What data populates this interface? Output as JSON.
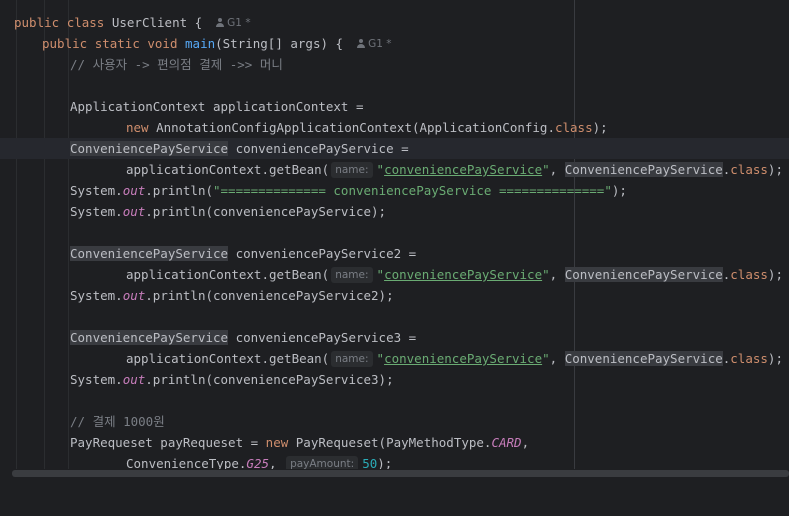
{
  "editor": {
    "author": "G1 *",
    "lines": {
      "l1": {
        "kw1": "public",
        "kw2": "class",
        "name": "UserClient {"
      },
      "l2": {
        "kw1": "public",
        "kw2": "static",
        "kw3": "void",
        "fn": "main",
        "rest": "(String[] args) {"
      },
      "l3": {
        "comment": "// 사용자 -> 편의점 결제 ->> 머니"
      },
      "l5": {
        "text": "ApplicationContext applicationContext ="
      },
      "l6": {
        "kw": "new",
        "text": "AnnotationConfigApplicationContext(ApplicationConfig.",
        "kw2": "class",
        "end": ");"
      },
      "l7": {
        "type": "ConveniencePayService",
        "text": " conveniencePayService ="
      },
      "l8": {
        "pre": "applicationContext.getBean(",
        "hint": "name:",
        "q1": "\"",
        "link": "conveniencePayService",
        "q2": "\"",
        "sep": ", ",
        "type": "ConveniencePayService",
        "dot": ".",
        "kw": "class",
        "end": ");"
      },
      "l9": {
        "pre": "System.",
        "out": "out",
        "mid": ".println(",
        "str": "\"============== conveniencePayService ==============\"",
        "end": ");"
      },
      "l10": {
        "pre": "System.",
        "out": "out",
        "rest": ".println(conveniencePayService);"
      },
      "l12": {
        "type": "ConveniencePayService",
        "text": " conveniencePayService2 ="
      },
      "l13": {
        "pre": "applicationContext.getBean(",
        "hint": "name:",
        "q1": "\"",
        "link": "conveniencePayService",
        "q2": "\"",
        "sep": ", ",
        "type": "ConveniencePayService",
        "dot": ".",
        "kw": "class",
        "end": ");"
      },
      "l14": {
        "pre": "System.",
        "out": "out",
        "rest": ".println(conveniencePayService2);"
      },
      "l16": {
        "type": "ConveniencePayService",
        "text": " conveniencePayService3 ="
      },
      "l17": {
        "pre": "applicationContext.getBean(",
        "hint": "name:",
        "q1": "\"",
        "link": "conveniencePayService",
        "q2": "\"",
        "sep": ", ",
        "type": "ConveniencePayService",
        "dot": ".",
        "kw": "class",
        "end": ");"
      },
      "l18": {
        "pre": "System.",
        "out": "out",
        "rest": ".println(conveniencePayService3);"
      },
      "l20": {
        "comment": "// 결제 1000원"
      },
      "l21": {
        "pre": "PayRequeset payRequeset = ",
        "kw": "new",
        "mid": " PayRequeset(PayMethodType.",
        "field": "CARD",
        "end": ","
      },
      "l22": {
        "pre": "ConvenienceType.",
        "field": "G25",
        "sep": ", ",
        "hint": "payAmount:",
        "num": "50",
        "end": ");"
      }
    }
  }
}
